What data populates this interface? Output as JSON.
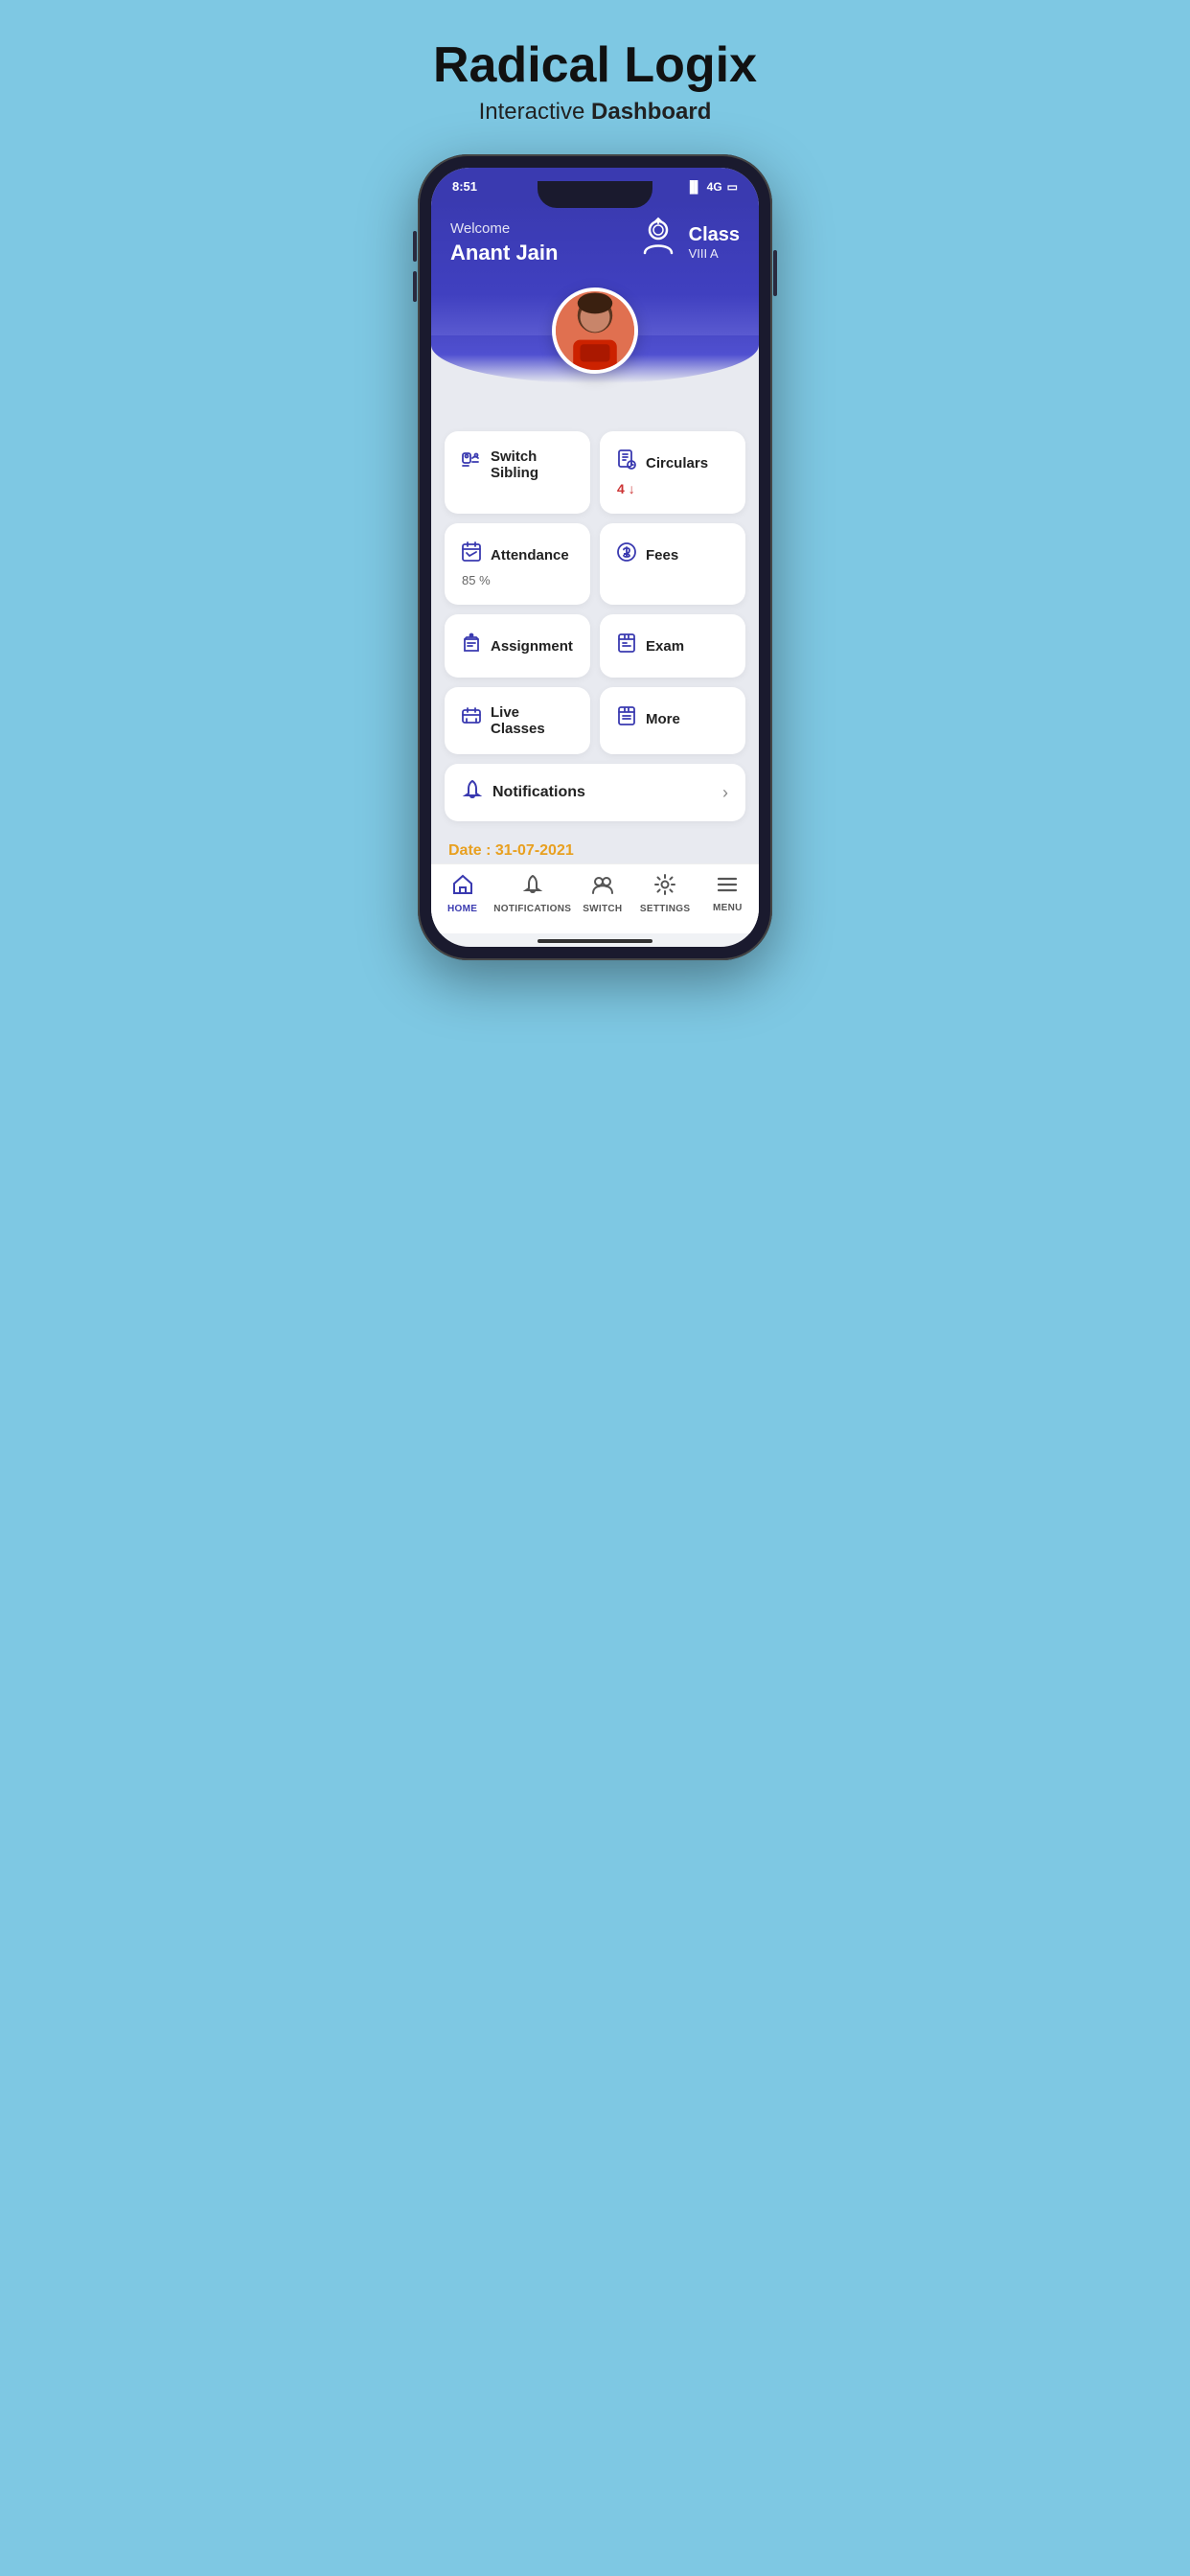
{
  "header": {
    "app_name": "Radical Logix",
    "subtitle_plain": "Interactive ",
    "subtitle_bold": "Dashboard"
  },
  "status_bar": {
    "time": "8:51",
    "signal": "4G",
    "battery": "▓"
  },
  "app_header": {
    "welcome_label": "Welcome",
    "student_name": "Anant  Jain",
    "class_label": "Class",
    "class_value": "VIII A"
  },
  "menu_items": [
    {
      "id": "switch-sibling",
      "icon": "🔍",
      "label": "Switch Sibling",
      "sub": ""
    },
    {
      "id": "circulars",
      "icon": "📋",
      "label": "Circulars",
      "sub": "4"
    },
    {
      "id": "attendance",
      "icon": "📅",
      "label": "Attendance",
      "sub": "85 %"
    },
    {
      "id": "fees",
      "icon": "💰",
      "label": "Fees",
      "sub": ""
    },
    {
      "id": "assignment",
      "icon": "🏫",
      "label": "Assignment",
      "sub": ""
    },
    {
      "id": "exam",
      "icon": "📄",
      "label": "Exam",
      "sub": ""
    },
    {
      "id": "live-classes",
      "icon": "📅",
      "label": "Live Classes",
      "sub": ""
    },
    {
      "id": "more",
      "icon": "📋",
      "label": "More",
      "sub": ""
    }
  ],
  "notifications": {
    "label": "Notifications",
    "icon": "🔔"
  },
  "date_bar": {
    "label": "Date : 31-07-2021"
  },
  "bottom_nav": [
    {
      "id": "home",
      "icon": "⌂",
      "label": "HOME",
      "active": true
    },
    {
      "id": "notifications",
      "icon": "🔔",
      "label": "NOTIFICATIONS",
      "active": false
    },
    {
      "id": "switch",
      "icon": "👥",
      "label": "SWITCH",
      "active": false
    },
    {
      "id": "settings",
      "icon": "⚙",
      "label": "SETTINGS",
      "active": false
    },
    {
      "id": "menu",
      "icon": "☰",
      "label": "MENU",
      "active": false
    }
  ]
}
